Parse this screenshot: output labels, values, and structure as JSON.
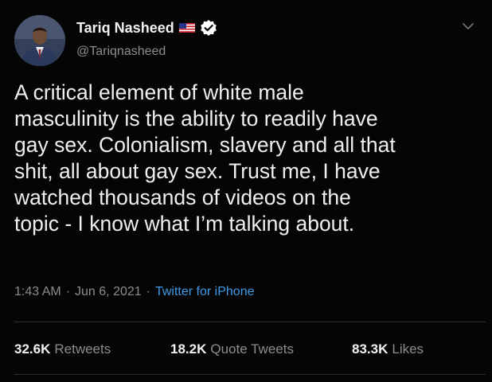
{
  "author": {
    "name": "Tariq Nasheed",
    "handle": "@Tariqnasheed",
    "flag_icon": "us-flag-icon",
    "verified_icon": "verified-badge-icon"
  },
  "tweet": {
    "lines": [
      "A critical element of white male",
      "masculinity is the ability to readily have",
      "gay sex. Colonialism, slavery and all that",
      "shit, all about gay sex. Trust me, I have",
      "watched thousands of videos on the",
      "topic - I know what I’m talking about."
    ]
  },
  "meta": {
    "time": "1:43 AM",
    "separator": "·",
    "date": "Jun 6, 2021",
    "source": "Twitter for iPhone"
  },
  "stats": {
    "retweets": {
      "count": "32.6K",
      "label": "Retweets"
    },
    "quotes": {
      "count": "18.2K",
      "label": "Quote Tweets"
    },
    "likes": {
      "count": "83.3K",
      "label": "Likes"
    }
  },
  "colors": {
    "background": "#050505",
    "text": "#efefef",
    "muted": "#8a8d91",
    "link": "#3f9be8"
  }
}
